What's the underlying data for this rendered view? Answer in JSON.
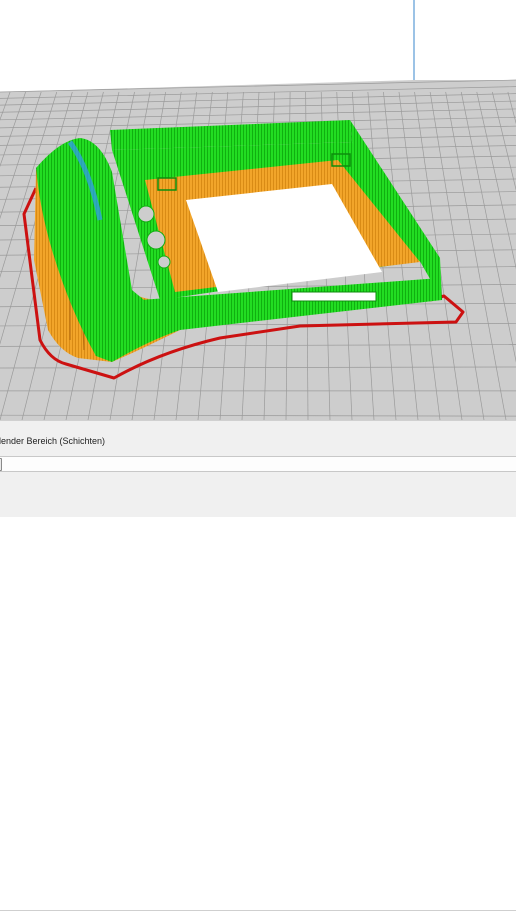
{
  "viewport": {
    "scene": "3d-print-layer-preview",
    "colors": {
      "background": "#ffffff",
      "bed": "#cdcdcd",
      "bed_grid": "#9a9a9a",
      "bed_axis": "#5b9bd5",
      "perimeter": "#22dd22",
      "infill": "#f2a52a",
      "skirt": "#cc1111",
      "highlight": "#3399ee"
    }
  },
  "panel": {
    "range_label": "lender Bereich (Schichten)"
  }
}
